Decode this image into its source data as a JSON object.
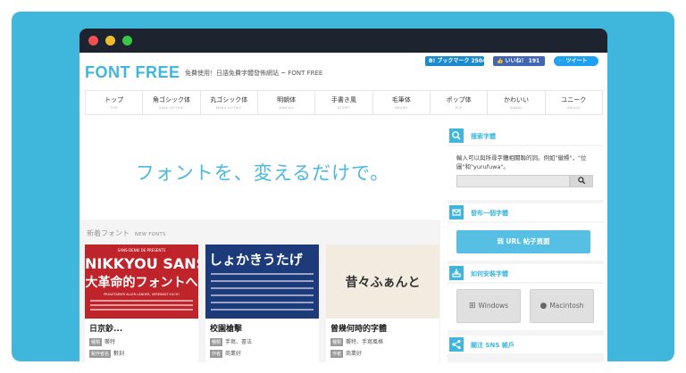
{
  "header": {
    "logo": "FONT FREE",
    "tagline": "免費使用！日語免費字體發佈網站 ~ FONT FREE",
    "share": {
      "hatena": "B! ブックマーク 2504",
      "like": "👍 いいね！ 191",
      "tweet": "🐦 ツイート"
    }
  },
  "nav": [
    {
      "label": "トップ",
      "sub": "TOP"
    },
    {
      "label": "角ゴシック体",
      "sub": "KAKU GOTHIC"
    },
    {
      "label": "丸ゴシック体",
      "sub": "MARU GOTHIC"
    },
    {
      "label": "明朝体",
      "sub": "MINCHO"
    },
    {
      "label": "手書き風",
      "sub": "SCRIPT"
    },
    {
      "label": "毛筆体",
      "sub": "BRUSH"
    },
    {
      "label": "ポップ体",
      "sub": "POP"
    },
    {
      "label": "かわいい",
      "sub": "KAWAII"
    },
    {
      "label": "ユニーク",
      "sub": "UNIQUE"
    }
  ],
  "hero": {
    "text": "フォントを、変えるだけで。"
  },
  "new_fonts": {
    "title": "新着フォント",
    "sub": "NEW FONTS",
    "cards": [
      {
        "thumb_top": "SANS-DENKI DE PRESENTS",
        "thumb_big": "NIKKYOU SANS",
        "thumb_jp": "大革命的フォントへ",
        "thumb_small": "PROLETARIER ALLER LÄNDER, VEREINIGT EUCH!",
        "name": "日京鈔...",
        "tag1": "種類",
        "val1": "襲特",
        "tag2": "製作者名",
        "val2": "數刻"
      },
      {
        "thumb_big": "しょかきうたげ",
        "name": "校園槍擊",
        "tag1": "種類",
        "val1": "手寫、書法",
        "tag2": "作者",
        "val2": "商業好"
      },
      {
        "thumb_big": "昔々ふぁんと",
        "name": "曾幾何時的字體",
        "tag1": "種類",
        "val1": "襲特、手寫風格",
        "tag2": "作者",
        "val2": "商業好"
      }
    ]
  },
  "sidebar": {
    "search": {
      "title": "搜索字體",
      "desc": "輸入可以與所尋字體相關聯的詞。例如\"徽標\"，\"位圖\"和\"yurufuwa\"。"
    },
    "submit": {
      "title": "發布一個字體",
      "button": "到 URL 帖子頁面"
    },
    "install": {
      "title": "如何安裝字體",
      "windows": "Windows",
      "mac": "Macintosh"
    },
    "sns": {
      "title": "關注 SNS 帳戶"
    }
  },
  "colors": {
    "accent": "#3fb6dc",
    "frame_bg": "#3fb6dc",
    "titlebar": "#1d2430"
  }
}
